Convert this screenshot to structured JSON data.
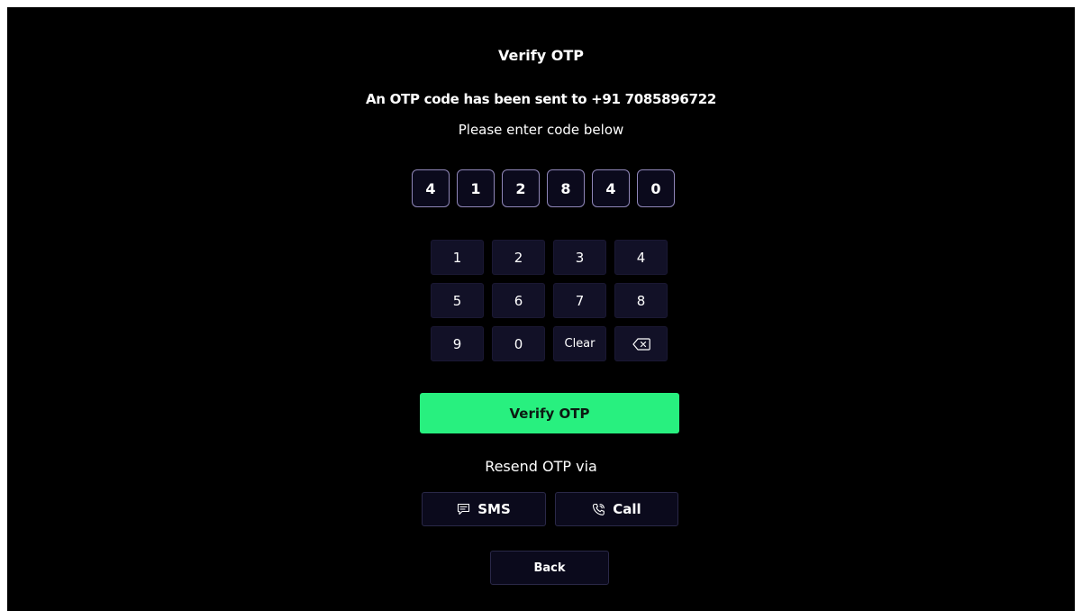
{
  "header": {
    "title": "Verify OTP",
    "sent_message": "An OTP code has been sent to +91 7085896722",
    "instruction": "Please enter code below"
  },
  "otp": {
    "digits": [
      "4",
      "1",
      "2",
      "8",
      "4",
      "0"
    ]
  },
  "keypad": {
    "keys": [
      "1",
      "2",
      "3",
      "4",
      "5",
      "6",
      "7",
      "8",
      "9",
      "0",
      "Clear"
    ],
    "backspace_icon": "backspace-icon"
  },
  "actions": {
    "verify_label": "Verify OTP",
    "resend_label": "Resend OTP via",
    "sms_label": "SMS",
    "sms_icon": "message-icon",
    "call_label": "Call",
    "call_icon": "phone-icon",
    "back_label": "Back"
  },
  "colors": {
    "background": "#000000",
    "accent_green": "#28f07f",
    "input_border": "#8f86b8",
    "key_background": "#121127"
  }
}
